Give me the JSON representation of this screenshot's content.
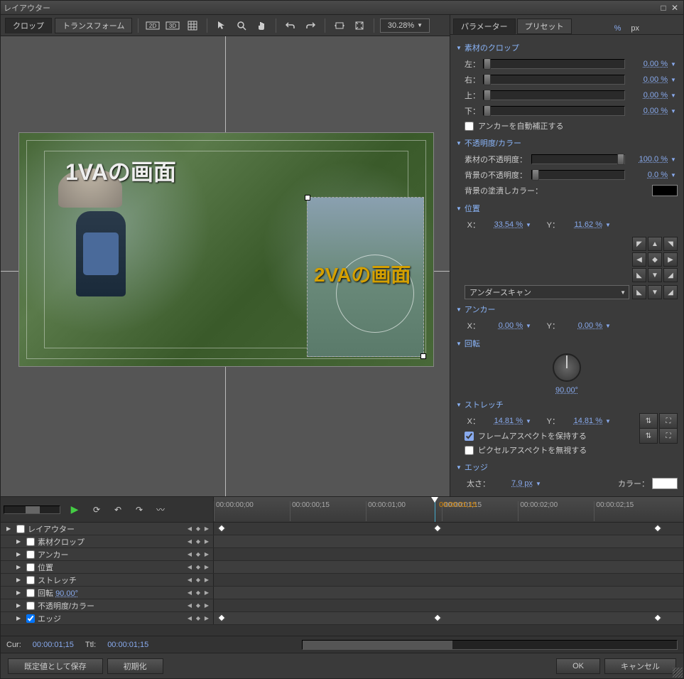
{
  "window": {
    "title": "レイアウター"
  },
  "tabs": {
    "crop": "クロップ",
    "transform": "トランスフォーム"
  },
  "toolbar": {
    "mode_2d": "2D",
    "mode_3d": "3D",
    "zoom_value": "30.28%"
  },
  "preview": {
    "label_main": "1VAの画面",
    "label_pip": "2VAの画面"
  },
  "panel_tabs": {
    "parameter": "パラメーター",
    "preset": "プリセット"
  },
  "unit": {
    "percent": "%",
    "px": "px"
  },
  "sections": {
    "crop": {
      "title": "素材のクロップ",
      "left_label": "左：",
      "left_val": "0.00 %",
      "right_label": "右：",
      "right_val": "0.00 %",
      "top_label": "上：",
      "top_val": "0.00 %",
      "bottom_label": "下：",
      "bottom_val": "0.00 %",
      "auto_anchor": "アンカーを自動補正する"
    },
    "opacity": {
      "title": "不透明度/カラー",
      "mat_op": "素材の不透明度：",
      "mat_op_val": "100.0 %",
      "bg_op": "背景の不透明度：",
      "bg_op_val": "0.0 %",
      "bg_fill": "背景の塗潰しカラー："
    },
    "position": {
      "title": "位置",
      "x_label": "X：",
      "x_val": "33.54 %",
      "y_label": "Y：",
      "y_val": "11.62 %",
      "underscan": "アンダースキャン"
    },
    "anchor": {
      "title": "アンカー",
      "x_label": "X：",
      "x_val": "0.00 %",
      "y_label": "Y：",
      "y_val": "0.00 %"
    },
    "rotation": {
      "title": "回転",
      "value": "90.00°"
    },
    "stretch": {
      "title": "ストレッチ",
      "x_label": "X：",
      "x_val": "14.81 %",
      "y_label": "Y：",
      "y_val": "14.81 %",
      "keep_aspect": "フレームアスペクトを保持する",
      "ignore_px_aspect": "ピクセルアスペクトを無視する"
    },
    "edge": {
      "title": "エッジ",
      "thick_label": "太さ：",
      "thick_val": "7.9 px",
      "color_label": "カラー："
    }
  },
  "timeline": {
    "ruler": [
      "00:00:00;00",
      "00:00:00;15",
      "00:00:01;00",
      "00:00:01;15",
      "00:00:02;00",
      "00:00:02;15"
    ],
    "playhead_label": "00:00:01;15",
    "tracks": [
      {
        "name": "レイアウター",
        "checked": false,
        "expandable": true,
        "has_kf": true,
        "indent": 0
      },
      {
        "name": "素材クロップ",
        "checked": false,
        "expandable": true,
        "has_kf": false,
        "indent": 1
      },
      {
        "name": "アンカー",
        "checked": false,
        "expandable": true,
        "has_kf": false,
        "indent": 1
      },
      {
        "name": "位置",
        "checked": false,
        "expandable": true,
        "has_kf": false,
        "indent": 1
      },
      {
        "name": "ストレッチ",
        "checked": false,
        "expandable": true,
        "has_kf": false,
        "indent": 1
      },
      {
        "name": "回転",
        "checked": false,
        "expandable": true,
        "has_kf": false,
        "indent": 1,
        "value": "90.00°"
      },
      {
        "name": "不透明度/カラー",
        "checked": false,
        "expandable": true,
        "has_kf": false,
        "indent": 1
      },
      {
        "name": "エッジ",
        "checked": true,
        "expandable": true,
        "has_kf": true,
        "indent": 1
      }
    ],
    "cur_label": "Cur:",
    "cur_val": "00:00:01;15",
    "ttl_label": "Ttl:",
    "ttl_val": "00:00:01;15"
  },
  "buttons": {
    "save_default": "既定値として保存",
    "init": "初期化",
    "ok": "OK",
    "cancel": "キャンセル"
  }
}
